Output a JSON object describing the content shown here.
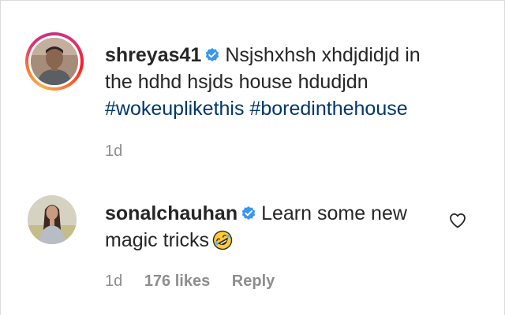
{
  "caption": {
    "username": "shreyas41",
    "text": "Nsjshxhsh xhdjdidjd in the hdhd hsjds house hdudjdn",
    "hashtags": [
      "#wokeuplikethis",
      "#boredinthehouse"
    ],
    "time": "1d",
    "avatar": "profile-photo",
    "verified_icon": "verified-badge-icon"
  },
  "comment": {
    "username": "sonalchauhan",
    "text": "Learn some new magic tricks",
    "emoji": "rolling-on-floor-laughing",
    "time": "1d",
    "likes": "176 likes",
    "reply_label": "Reply",
    "like_icon": "heart-outline-icon",
    "verified_icon": "verified-badge-icon"
  },
  "colors": {
    "text": "#262626",
    "secondary": "#8e8e8e",
    "hashtag": "#00376b",
    "verified": "#3897f0",
    "story_ring": "#e1306c"
  }
}
